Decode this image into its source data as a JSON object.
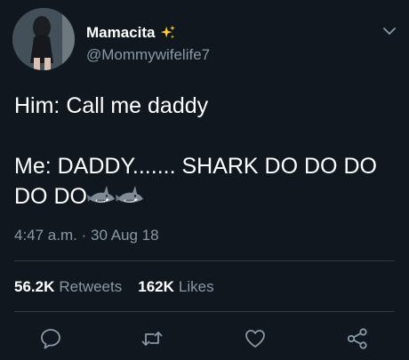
{
  "tweet": {
    "author": {
      "display_name": "Mamacita",
      "handle": "@Mommywifelife7",
      "name_emoji": "sparkles-icon"
    },
    "text_lines": [
      "Him: Call me daddy",
      "",
      "Me: DADDY....... SHARK DO DO DO",
      "DO DO"
    ],
    "text_emoji": [
      "shark-icon",
      "shark-icon"
    ],
    "timestamp": {
      "time": "4:47 a.m.",
      "separator": "·",
      "date": "30 Aug 18"
    },
    "stats": {
      "retweets_count": "56.2K",
      "retweets_label": "Retweets",
      "likes_count": "162K",
      "likes_label": "Likes"
    },
    "actions": [
      "reply-icon",
      "retweet-icon",
      "like-icon",
      "share-icon"
    ]
  },
  "colors": {
    "background": "#10171e",
    "primary_text": "#ffffff",
    "secondary_text": "#8899a6",
    "divider": "#2f3b45",
    "sparkle": "#ffcc33"
  }
}
